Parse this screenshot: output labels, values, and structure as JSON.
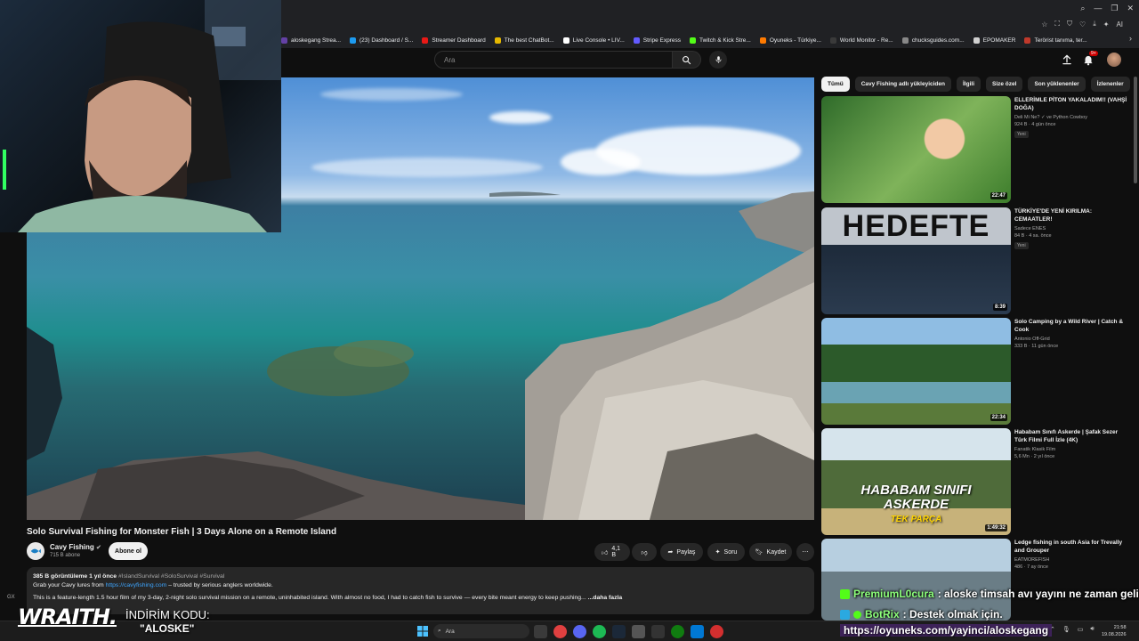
{
  "browser": {
    "bookmarks": [
      {
        "label": "aloskegang Strea...",
        "color": "#6441a5"
      },
      {
        "label": "(23) Dashboard / S...",
        "color": "#1d9bf0"
      },
      {
        "label": "Streamer Dashboard",
        "color": "#e91916"
      },
      {
        "label": "The best ChatBot...",
        "color": "#e6b800"
      },
      {
        "label": "Live Console • LIV...",
        "color": "#ffffff"
      },
      {
        "label": "Stripe Express",
        "color": "#635bff"
      },
      {
        "label": "Twitch & Kick Stre...",
        "color": "#53fc18"
      },
      {
        "label": "Oyuneks - Türkiye...",
        "color": "#ff7a00"
      },
      {
        "label": "World Monitor - Re...",
        "color": "#3a3a3a"
      },
      {
        "label": "chucksguides.com...",
        "color": "#888888"
      },
      {
        "label": "EPOMAKER",
        "color": "#d0d0d0"
      },
      {
        "label": "Terörist tanıma, ter...",
        "color": "#c0392b"
      }
    ],
    "ext_ai_label": "AI"
  },
  "header": {
    "search_placeholder": "Ara",
    "notification_count": "9+"
  },
  "video": {
    "title": "Solo Survival Fishing for Monster Fish | 3 Days Alone on a Remote Island",
    "channel": "Cavy Fishing",
    "subscribers": "715 B abone",
    "subscribe_label": "Abone ol",
    "likes": "4,1 B",
    "share_label": "Paylaş",
    "ask_label": "Soru",
    "save_label": "Kaydet",
    "views_line": "385 B görüntüleme  1 yıl önce",
    "tags": "#IslandSurvival #SoloSurvival #Survival",
    "desc_prefix": "Grab your Cavy lures from ",
    "desc_link": "https://cavyfishing.com",
    "desc_suffix": " – trusted by serious anglers worldwide.",
    "desc_line2": "This is a feature-length 1.5 hour film of my 3-day, 2-night solo survival mission on a remote, uninhabited island. With almost no food, I had to catch fish to survive — every bite meant energy to keep pushing...",
    "more_label": "...daha fazla"
  },
  "sidebar": {
    "chips": [
      "Tümü",
      "Cavy Fishing adlı yükleyiciden",
      "İlgili",
      "Size özel",
      "Son yüklenenler",
      "İzlenenler"
    ],
    "recommendations": [
      {
        "title": "ELLERİMLE PİTON YAKALADIM!! (VAHŞİ DOĞA)",
        "channel": "Deli Mi Ne? ✓ ve Python Cowboy",
        "meta": "924 B · 4 gün önce",
        "badge": "Yeni",
        "duration": "22:47"
      },
      {
        "title": "TÜRKİYE'DE YENİ KIRILMA: CEMAATLER!",
        "channel": "Sadece ENES",
        "meta": "84 B · 4 sa. önce",
        "badge": "Yeni",
        "duration": "8:39",
        "thumb_text": "HEDEFTE"
      },
      {
        "title": "Solo Camping by a Wild River | Catch & Cook",
        "channel": "Antonio Off-Grid",
        "meta": "333 B · 11 gün önce",
        "badge": "",
        "duration": "22:34"
      },
      {
        "title": "Hababam Sınıfı Askerde | Şafak Sezer Türk Filmi Full İzle (4K)",
        "channel": "Fanatik Klasik Film",
        "meta": "5,6 Mn · 2 yıl önce",
        "badge": "",
        "duration": "1:49:32",
        "thumb_text": "HABABAM SINIFI ASKERDE",
        "thumb_sub": "TEK PARÇA"
      },
      {
        "title": "Ledge fishing in south Asia for Trevally and Grouper",
        "channel": "EATMOREFISH",
        "meta": "486 · 7 ay önce",
        "badge": "",
        "duration": ""
      }
    ]
  },
  "overlay": {
    "brand": "WRAITH.",
    "promo_label": "İNDİRİM KODU:",
    "promo_code": "\"ALOSKE\"",
    "chat": [
      {
        "user": "PremiumL0cura",
        "message": ": aloske timsah avı yayını ne zaman gelir"
      },
      {
        "user": "BotRix",
        "message": ": Destek olmak için."
      }
    ],
    "chat_link": "https://oyuneks.com/yayinci/aloskegang",
    "corner_label": "GX"
  },
  "taskbar": {
    "search_placeholder": "Ara",
    "time": "21:58",
    "date": "19.08.2026"
  },
  "colors": {
    "background": "#0f0f0f",
    "surface": "#272727",
    "link": "#3ea6ff",
    "chat_user": "#8cff7a"
  }
}
